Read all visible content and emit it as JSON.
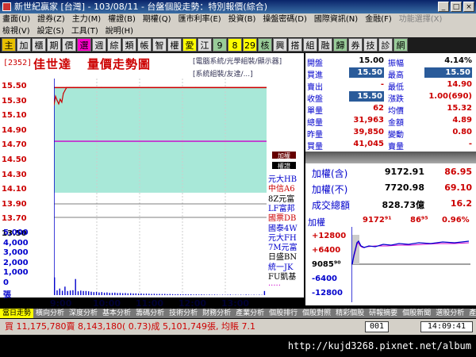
{
  "window": {
    "title": "新世紀贏家 [台灣] - 103/08/11 - 台盤個股走勢：特別報價(綜合)"
  },
  "menu": {
    "row1": [
      "畫面(U)",
      "證券(Z)",
      "主力(M)",
      "權證(B)",
      "期權(Q)",
      "匯市利率(E)",
      "投資(B)",
      "操盤密碼(D)",
      "國際資訊(N)",
      "金融(F)",
      "功能選擇(X)"
    ],
    "row1_dim": [
      "功能選擇(X)"
    ],
    "row2": [
      "檢視(V)",
      "設定(S)",
      "工具(T)",
      "說明(H)"
    ]
  },
  "toolbar": [
    "主",
    "加",
    "櫃",
    "期",
    "價",
    "選",
    "週",
    "綜",
    "類",
    "帳",
    "智",
    "權",
    "愛",
    "江",
    "9",
    "8",
    "29",
    "核",
    "興",
    "搭",
    "組",
    "融",
    "歸",
    "券",
    "技",
    "診",
    "網"
  ],
  "stock": {
    "code": "[2352]",
    "name": "佳世達",
    "chart_title": "量價走勢圖",
    "category1": "[電腦系統/光學組裝/顯示器]",
    "category2": "[系統組裝/友達/...]"
  },
  "price_ticks": [
    "15.50",
    "15.30",
    "15.10",
    "14.90",
    "14.70",
    "14.50",
    "14.30",
    "14.10",
    "13.90",
    "13.70",
    "13.50"
  ],
  "volume_ticks": [
    "5,000",
    "4,000",
    "3,000",
    "2,000",
    "1,000",
    "0",
    "張"
  ],
  "time_ticks": [
    "9:00",
    "10:00",
    "11:00",
    "12:00",
    "13:00"
  ],
  "chart_data": {
    "type": "line",
    "price": {
      "times": [
        "9:00",
        "9:02",
        "9:04",
        "9:06",
        "9:08",
        "9:10",
        "9:12",
        "9:14",
        "9:16",
        "9:20",
        "9:25",
        "9:30",
        "10:00",
        "11:00",
        "12:00",
        "13:00",
        "13:30"
      ],
      "values": [
        15.2,
        15.35,
        15.28,
        15.22,
        15.3,
        15.25,
        15.4,
        15.45,
        15.5,
        15.5,
        15.5,
        15.5,
        15.5,
        15.5,
        15.5,
        15.5,
        15.5
      ],
      "ylim": [
        13.4,
        15.6
      ],
      "reference_price": 15.5,
      "average_line": 14.58
    },
    "volume": {
      "ylim": [
        0,
        5000
      ],
      "values": [
        1300,
        350,
        480,
        320,
        620,
        300,
        340,
        360,
        1180,
        280,
        330,
        300,
        300,
        280,
        250,
        220,
        240,
        200,
        220,
        180,
        200,
        160,
        170,
        180,
        150,
        160,
        140,
        150,
        130,
        140,
        120,
        130,
        110,
        120,
        100,
        110,
        100,
        90,
        100,
        80,
        90,
        80,
        90,
        70,
        80,
        70,
        60,
        70,
        60,
        50,
        60,
        50,
        60,
        40,
        50,
        40,
        50,
        40,
        30,
        40,
        30,
        40,
        30,
        20,
        30,
        20,
        30,
        40,
        20,
        30,
        20,
        30,
        20,
        40,
        30,
        20,
        30,
        20,
        30,
        20,
        300
      ]
    }
  },
  "brokers": {
    "headers": [
      "加權",
      "權證"
    ],
    "names": [
      "元大HB",
      "中信A6",
      "8Z元富",
      "LF富邦",
      "國票DB",
      "國泰4W",
      "元大FH",
      "7M元富",
      "日盛BN",
      "統一JK",
      "FU凱基",
      "....."
    ],
    "colors": [
      "#00c",
      "#c00",
      "#000",
      "#00c",
      "#c00",
      "#00c",
      "#00c",
      "#00c",
      "#000",
      "#00c",
      "#000",
      "#c0c"
    ]
  },
  "quote": {
    "left": [
      {
        "label": "開盤",
        "value": "15.00"
      },
      {
        "label": "買進",
        "value": "15.50",
        "boxed": true
      },
      {
        "label": "賣出",
        "value": "-"
      },
      {
        "label": "收盤",
        "value": "15.50",
        "boxed": true
      },
      {
        "label": "單量",
        "value": "62"
      },
      {
        "label": "總量",
        "value": "31,963"
      },
      {
        "label": "昨量",
        "value": "39,850"
      },
      {
        "label": "買量",
        "value": "41,045"
      }
    ],
    "right": [
      {
        "label": "振幅",
        "value": "4.14%"
      },
      {
        "label": "最高",
        "value": "15.50",
        "boxed": true
      },
      {
        "label": "最低",
        "value": "14.90"
      },
      {
        "label": "漲跌",
        "value": "1.00(690)"
      },
      {
        "label": "均價",
        "value": "15.32"
      },
      {
        "label": "金額",
        "value": "4.89"
      },
      {
        "label": "變動",
        "value": "0.80"
      },
      {
        "label": "賣量",
        "value": "-"
      }
    ]
  },
  "index": {
    "rows": [
      {
        "label": "加權(含)",
        "value": "9172.91",
        "change": "86.95"
      },
      {
        "label": "加權(不)",
        "value": "7720.98",
        "change": "69.10"
      },
      {
        "label": "成交總額",
        "value": "828.73億",
        "change": "16.2"
      }
    ],
    "chart_label": "加權",
    "chart_value": "9172⁹¹",
    "chart_change": "86⁹⁵",
    "chart_pct": "0.96%",
    "ticks": [
      "+12800",
      "+6400",
      "9085⁹⁰",
      "-6400",
      "-12800"
    ]
  },
  "tabs": [
    "當日走勢",
    "橫向分析",
    "深度分析",
    "基本分析",
    "籌碼分析",
    "技術分析",
    "財務分析",
    "產業分析",
    "個股排行",
    "個股對照",
    "精彩個股",
    "研報摘要",
    "個股新聞",
    "選股分析",
    "產業分析"
  ],
  "status": {
    "ticker": "買 11,175,780賣 8,143,180( 0.73)成 5,101,749張, 均賬 7.1",
    "code": "001",
    "time": "14:09:41"
  },
  "watermark": "http://kujd3268.pixnet.net/album"
}
